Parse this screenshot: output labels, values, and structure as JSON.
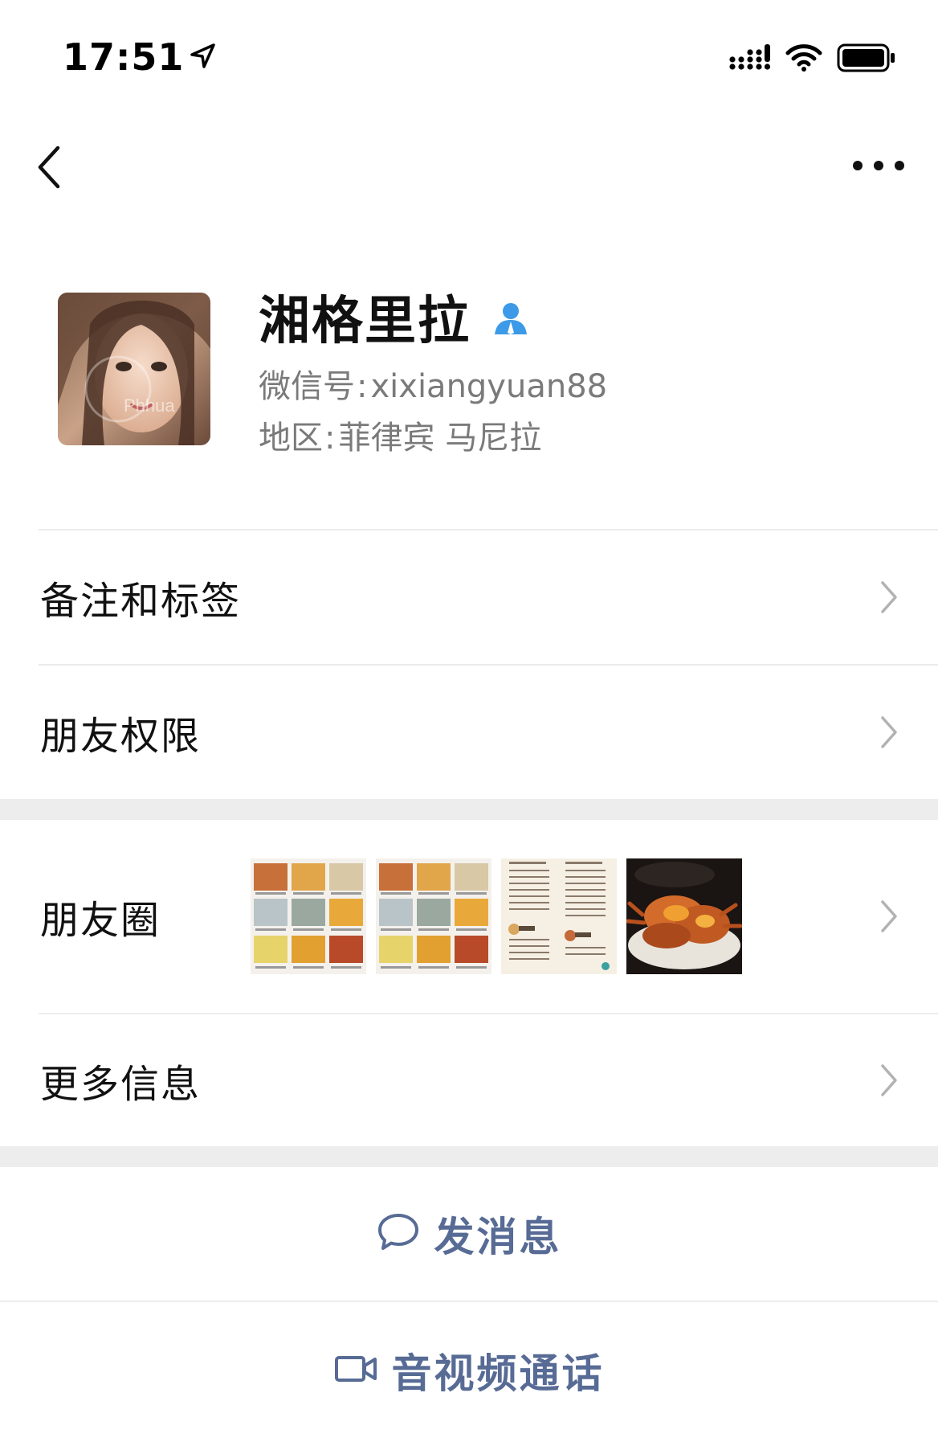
{
  "status_bar": {
    "time": "17:51"
  },
  "profile": {
    "name": "湘格里拉",
    "wechat_id_label": "微信号",
    "wechat_id_value": "xixiangyuan88",
    "region_label": "地区",
    "region_value": "菲律宾 马尼拉",
    "avatar_watermark": "Phhua"
  },
  "menu": {
    "remarks_tags": "备注和标签",
    "friend_permissions": "朋友权限",
    "moments": "朋友圈",
    "more_info": "更多信息"
  },
  "actions": {
    "send_message": "发消息",
    "video_call": "音视频通话"
  },
  "colors": {
    "link_blue": "#576b95",
    "separator": "#ececec",
    "gap_band": "#ededed",
    "person_icon": "#3d9ae8"
  },
  "icons": {
    "back": "chevron-left-icon",
    "more": "ellipsis-icon",
    "verified": "person-icon",
    "chevron": "chevron-right-icon",
    "message": "chat-bubble-icon",
    "video": "video-camera-icon"
  }
}
